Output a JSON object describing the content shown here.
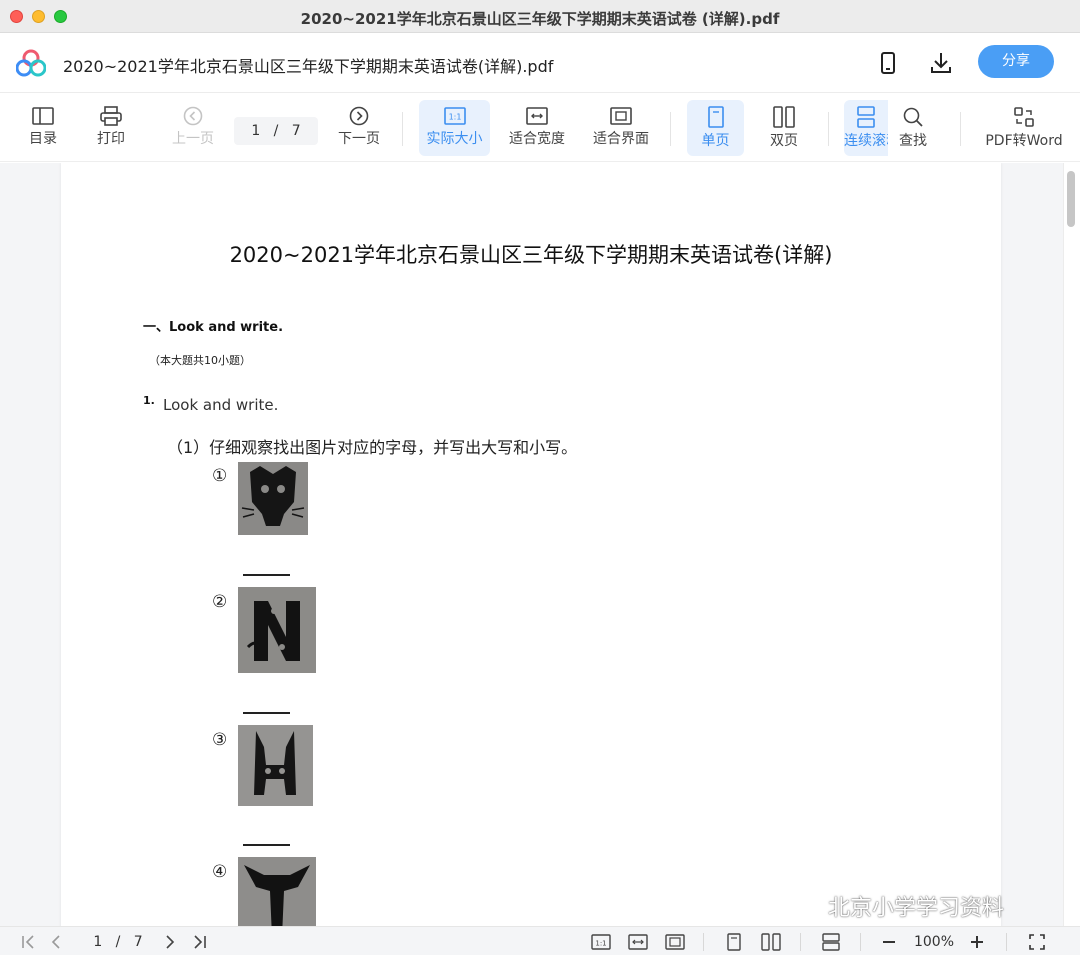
{
  "window": {
    "title": "2020~2021学年北京石景山区三年级下学期期末英语试卷 (详解).pdf"
  },
  "header": {
    "file_name": "2020~2021学年北京石景山区三年级下学期期末英语试卷(详解).pdf",
    "share_label": "分享"
  },
  "toolbar": {
    "toc": "目录",
    "print": "打印",
    "prev": "上一页",
    "page_current": "1",
    "page_sep": "/",
    "page_total": "7",
    "next": "下一页",
    "actual_size": "实际大小",
    "fit_width": "适合宽度",
    "fit_page": "适合界面",
    "single": "单页",
    "double": "双页",
    "continuous": "连续滚动",
    "find": "查找",
    "pdf_to_word": "PDF转Word"
  },
  "document": {
    "title": "2020~2021学年北京石景山区三年级下学期期末英语试卷(详解)",
    "section_heading": "一、Look and write.",
    "section_note": "（本大题共10小题）",
    "question_number": "1.",
    "question_text": "Look and write.",
    "sub_question": "（1）仔细观察找出图片对应的字母，并写出大写和小写。",
    "items": [
      "①",
      "②",
      "③",
      "④"
    ]
  },
  "bottombar": {
    "page_current": "1",
    "page_sep": "/",
    "page_total": "7",
    "zoom": "100%"
  },
  "watermark": "北京小学学习资料",
  "colors": {
    "accent": "#4a9ef5",
    "active_bg": "#e8f1fd",
    "active_text": "#3b8ef0"
  }
}
